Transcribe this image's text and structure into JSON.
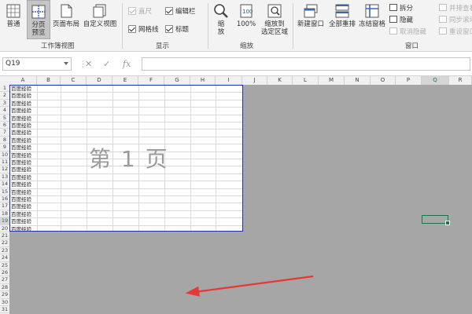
{
  "ribbon": {
    "workbook_views": {
      "group_label": "工作簿视图",
      "buttons": [
        {
          "label": "普通"
        },
        {
          "label": "分页\n预览",
          "active": true
        },
        {
          "label": "页面布局"
        },
        {
          "label": "自定义视图"
        }
      ]
    },
    "show": {
      "group_label": "显示",
      "items": [
        {
          "label": "直尺",
          "checked": true,
          "disabled": true
        },
        {
          "label": "编辑栏",
          "checked": true,
          "disabled": false
        },
        {
          "label": "网格线",
          "checked": true,
          "disabled": false
        },
        {
          "label": "标题",
          "checked": true,
          "disabled": false
        }
      ]
    },
    "zoom": {
      "group_label": "缩放",
      "buttons": [
        {
          "label": "缩\n放"
        },
        {
          "label": "100%"
        },
        {
          "label": "缩放到\n选定区域"
        }
      ]
    },
    "window": {
      "group_label": "窗口",
      "buttons": [
        {
          "label": "新建窗口"
        },
        {
          "label": "全部重排"
        },
        {
          "label": "冻结窗格"
        }
      ],
      "small_items": [
        {
          "label": "拆分",
          "disabled": false
        },
        {
          "label": "隐藏",
          "disabled": false
        },
        {
          "label": "取消隐藏",
          "disabled": true
        }
      ],
      "right_items": [
        {
          "label": "并排查看",
          "disabled": true
        },
        {
          "label": "同步滚动",
          "disabled": true
        },
        {
          "label": "重设窗口位置",
          "disabled": true
        }
      ]
    }
  },
  "formula_bar": {
    "name_box": "Q19",
    "cancel_symbol": "✕",
    "enter_symbol": "✓",
    "fx_symbol": "fx",
    "formula": ""
  },
  "sheet": {
    "columns": [
      "A",
      "B",
      "C",
      "D",
      "E",
      "F",
      "G",
      "H",
      "I",
      "J",
      "K",
      "L",
      "M",
      "N",
      "O",
      "P",
      "Q",
      "R"
    ],
    "rows": [
      "1",
      "2",
      "3",
      "4",
      "5",
      "6",
      "7",
      "8",
      "9",
      "10",
      "11",
      "12",
      "13",
      "14",
      "15",
      "16",
      "17",
      "18",
      "19",
      "20",
      "21",
      "22",
      "23",
      "24",
      "25",
      "26",
      "27",
      "28",
      "29",
      "30",
      "31"
    ],
    "cell_text": "百度经验",
    "page_label": "第 1 页",
    "selected_cell": "Q19"
  },
  "colors": {
    "page_border": "#1f2fa8",
    "selection": "#217346",
    "annotation_arrow": "#e53935",
    "outside_area": "#a6a6a6"
  }
}
